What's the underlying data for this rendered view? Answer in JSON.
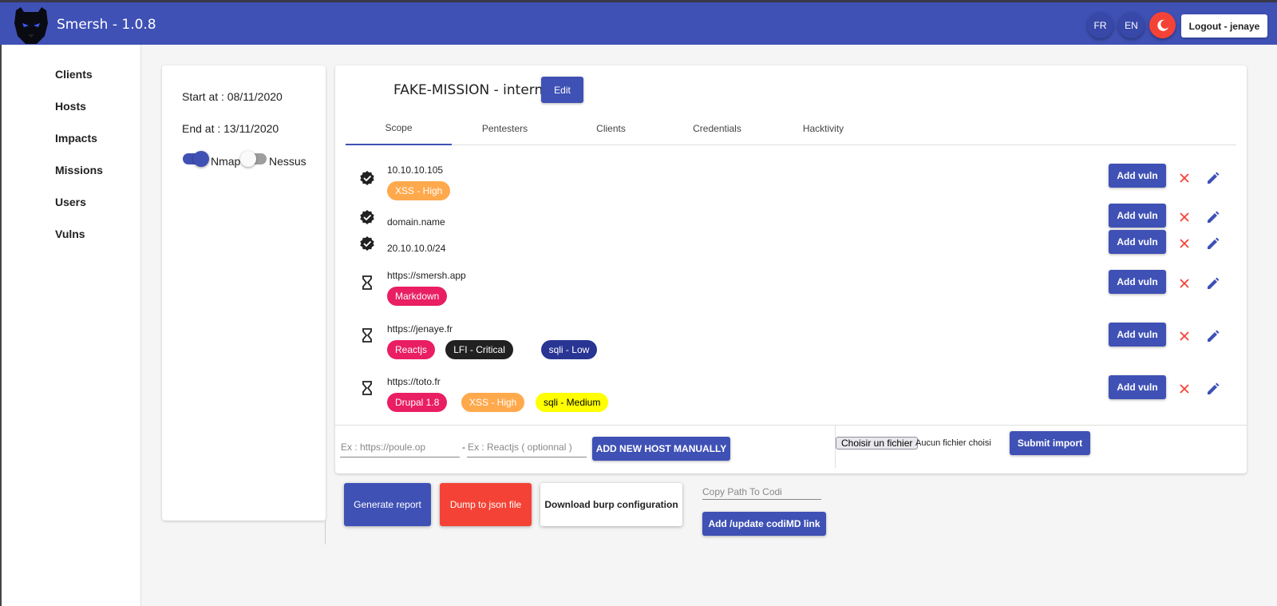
{
  "header": {
    "title": "Smersh - 1.0.8",
    "lang_fr": "FR",
    "lang_en": "EN",
    "logout_label": "Logout - jenaye"
  },
  "sidebar": {
    "items": [
      {
        "label": "Clients"
      },
      {
        "label": "Hosts"
      },
      {
        "label": "Impacts"
      },
      {
        "label": "Missions"
      },
      {
        "label": "Users"
      },
      {
        "label": "Vulns"
      }
    ]
  },
  "info": {
    "start": "Start at : 08/11/2020",
    "end": "End at : 13/11/2020",
    "nmap_label": "Nmap",
    "nmap_on": true,
    "nessus_label": "Nessus",
    "nessus_on": false
  },
  "mission": {
    "title": "FAKE-MISSION - interne",
    "edit_label": "Edit",
    "tabs": [
      {
        "label": "Scope",
        "active": true
      },
      {
        "label": "Pentesters"
      },
      {
        "label": "Clients"
      },
      {
        "label": "Credentials"
      },
      {
        "label": "Hacktivity"
      }
    ]
  },
  "hosts": [
    {
      "name": "10.10.10.105",
      "status": "checked",
      "chips": [
        {
          "label": "XSS - High",
          "color": "#ffa94d",
          "text": "#ffffff"
        }
      ]
    },
    {
      "name": "domain.name",
      "status": "checked",
      "chips": []
    },
    {
      "name": "20.10.10.0/24",
      "status": "checked",
      "chips": []
    },
    {
      "name": "https://smersh.app",
      "status": "pending",
      "chips": [
        {
          "label": "Markdown",
          "color": "#e91e63",
          "text": "#ffffff"
        }
      ]
    },
    {
      "name": "https://jenaye.fr",
      "status": "pending",
      "chips": [
        {
          "label": "Reactjs",
          "color": "#e91e63",
          "text": "#ffffff"
        },
        {
          "label": "LFI - Critical",
          "color": "#212121",
          "text": "#ffffff"
        },
        {
          "label": "sqli - Low",
          "color": "#283593",
          "text": "#ffffff"
        }
      ]
    },
    {
      "name": "https://toto.fr",
      "status": "pending",
      "chips": [
        {
          "label": "Drupal 1.8",
          "color": "#e91e63",
          "text": "#ffffff"
        },
        {
          "label": "XSS - High",
          "color": "#ffa94d",
          "text": "#ffffff"
        },
        {
          "label": "sqli - Medium",
          "color": "#ffff00",
          "text": "#000000"
        }
      ]
    }
  ],
  "host_actions": {
    "add_vuln_label": "Add vuln"
  },
  "add_host": {
    "host_placeholder": "Ex : https://poule.op",
    "dash": "-",
    "tech_placeholder": "Ex : Reactjs ( optionnal )",
    "button_label": "ADD NEW HOST MANUALLY"
  },
  "import": {
    "file_button": "Choisir un fichier",
    "file_status": "Aucun fichier choisi",
    "submit_label": "Submit import"
  },
  "actions": {
    "generate_report": "Generate report",
    "dump_json": "Dump to json file",
    "download_burp": "Download burp configuration",
    "codi_placeholder": "Copy Path To Codi",
    "codi_button": "Add /update codiMD link"
  },
  "colors": {
    "primary": "#3f51b5",
    "danger": "#f44336"
  }
}
